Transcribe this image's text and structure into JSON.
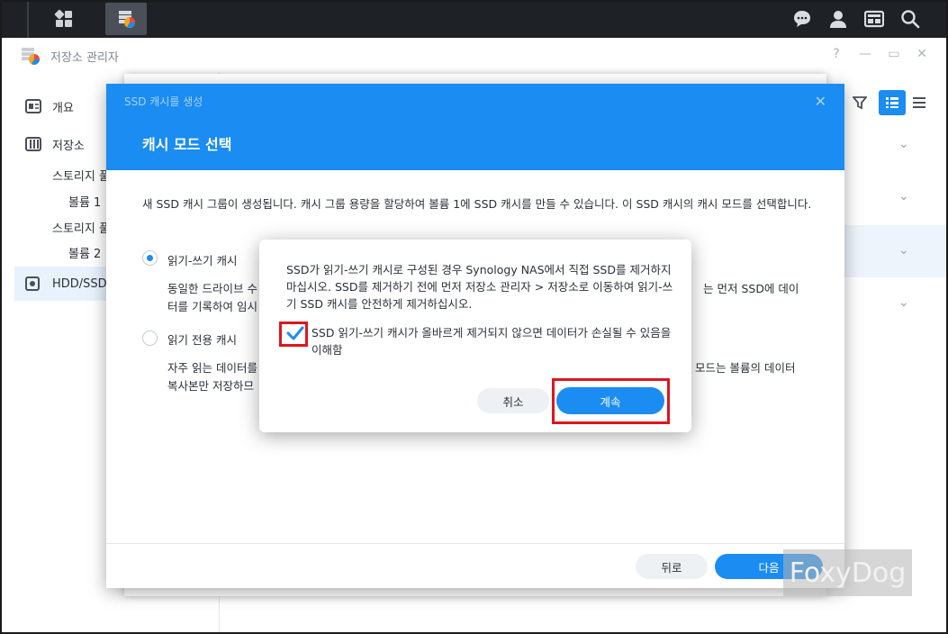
{
  "window": {
    "title": "저장소 관리자"
  },
  "window_controls": {
    "help": "?",
    "minimize": "—",
    "restore": "▭",
    "close": "✕"
  },
  "sidebar": {
    "overview": "개요",
    "storage": "저장소",
    "pool_1": "스토리지 풀",
    "volume_1": "볼륨 1",
    "pool_2": "스토리지 풀",
    "volume_2": "볼륨 2",
    "hdd_ssd": "HDD/SSD"
  },
  "wizard": {
    "subtitle": "SSD 캐시를 생성",
    "close": "✕",
    "title": "캐시 모드 선택",
    "description": "새 SSD 캐시 그룹이 생성됩니다. 캐시 그룹 용량을 할당하여 볼륨 1에 SSD 캐시를 만들 수 있습니다. 이 SSD 캐시의 캐시 모드를 선택합니다.",
    "option_rw_label": "읽기-쓰기 캐시",
    "option_rw_desc_left": "동일한 드라이브 수",
    "option_rw_desc_right": "는 먼저 SSD에 데이",
    "option_rw_desc_line2": "터를 기록하여 임시",
    "option_ro_label": "읽기 전용 캐시",
    "option_ro_desc_left": "자주 읽는 데이터를",
    "option_ro_desc_right": "모드는 볼륨의 데이터",
    "option_ro_desc_line2": "복사본만 저장하므",
    "back_button": "뒤로",
    "next_button": "다음"
  },
  "confirm": {
    "message": "SSD가 읽기-쓰기 캐시로 구성된 경우 Synology NAS에서 직접 SSD를 제거하지 마십시오. SSD를 제거하기 전에 먼저 저장소 관리자 > 저장소로 이동하여 읽기-쓰기 SSD 캐시를 안전하게 제거하십시오.",
    "checkbox_label": "SSD 읽기-쓰기 캐시가 올바르게 제거되지 않으면 데이터가 손실될 수 있음을 이해함",
    "checkbox_checked": true,
    "cancel_button": "취소",
    "continue_button": "계속"
  },
  "watermark": "FoxyDog",
  "colors": {
    "accent": "#1a8cf2",
    "highlight": "#e0141e",
    "taskbar": "#1e2227"
  }
}
